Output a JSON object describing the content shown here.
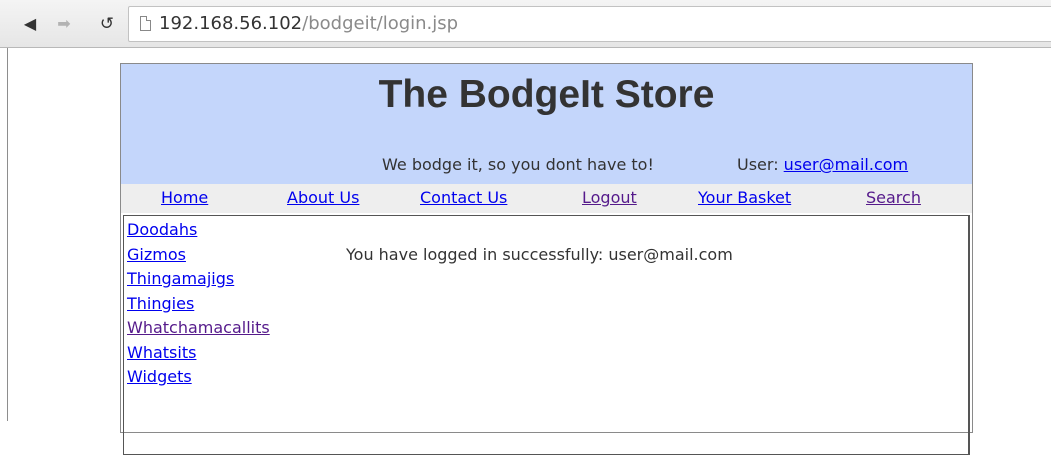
{
  "browser": {
    "back_icon": "back-arrow-icon",
    "forward_icon": "forward-arrow-icon",
    "reload_icon": "reload-icon",
    "page_icon": "page-icon",
    "url_host": "192.168.56.102",
    "url_path": "/bodgeit/login.jsp"
  },
  "header": {
    "title": "The BodgeIt Store",
    "tagline": "We bodge it, so you dont have to!",
    "user_label": "User:",
    "user_email": "user@mail.com",
    "background": "#c4d6fb"
  },
  "menu": {
    "items": [
      {
        "label": "Home",
        "state": "unvisited"
      },
      {
        "label": "About Us",
        "state": "unvisited"
      },
      {
        "label": "Contact Us",
        "state": "unvisited"
      },
      {
        "label": "Logout",
        "state": "visited"
      },
      {
        "label": "Your Basket",
        "state": "unvisited"
      },
      {
        "label": "Search",
        "state": "visited"
      }
    ]
  },
  "categories": [
    {
      "label": "Doodahs",
      "state": "unvisited"
    },
    {
      "label": "Gizmos",
      "state": "unvisited"
    },
    {
      "label": "Thingamajigs",
      "state": "unvisited"
    },
    {
      "label": "Thingies",
      "state": "unvisited"
    },
    {
      "label": "Whatchamacallits",
      "state": "visited"
    },
    {
      "label": "Whatsits",
      "state": "unvisited"
    },
    {
      "label": "Widgets",
      "state": "unvisited"
    }
  ],
  "main": {
    "message": "You have logged in successfully: user@mail.com"
  },
  "colors": {
    "link": "#0000ee",
    "visited_link": "#551a8b",
    "menu_background": "#eeeeee"
  }
}
